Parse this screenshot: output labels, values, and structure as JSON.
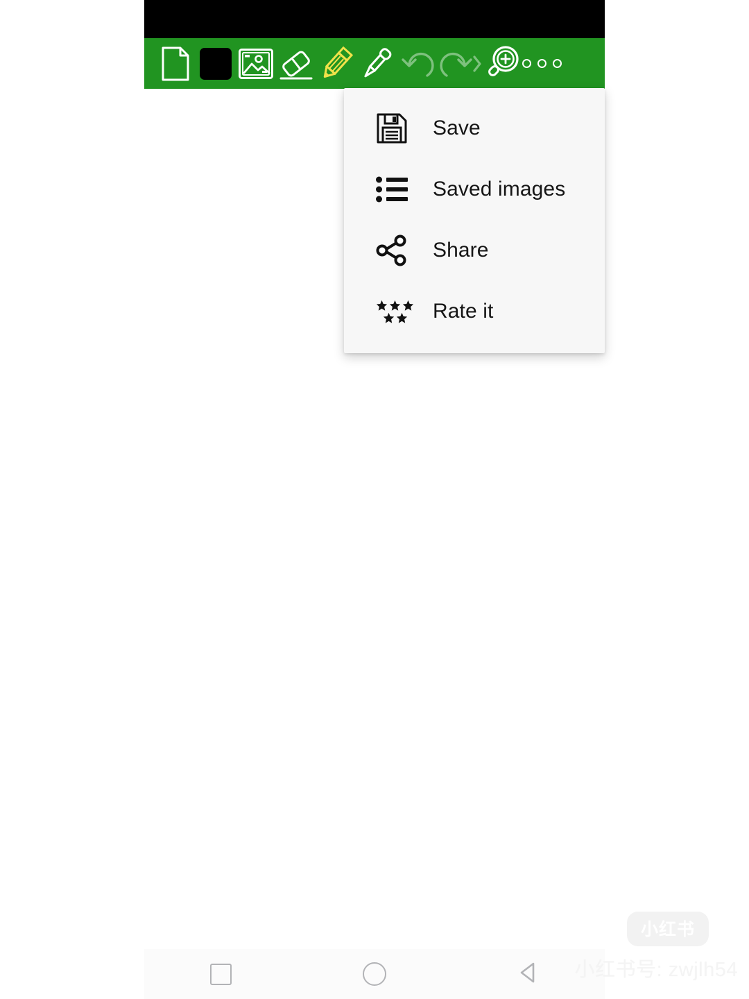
{
  "app": {
    "toolbar_color": "#219421",
    "status_bar_color": "#000000",
    "canvas_color": "#ffffff"
  },
  "toolbar": {
    "tools": [
      {
        "name": "new-page-icon",
        "label": "New page",
        "state": "enabled"
      },
      {
        "name": "color-swatch",
        "label": "Color",
        "state": "enabled",
        "color": "#000000"
      },
      {
        "name": "image-icon",
        "label": "Image",
        "state": "enabled"
      },
      {
        "name": "eraser-icon",
        "label": "Eraser",
        "state": "enabled"
      },
      {
        "name": "pencil-icon",
        "label": "Pencil",
        "state": "selected",
        "color": "#f0e24a"
      },
      {
        "name": "dropper-icon",
        "label": "Color picker",
        "state": "enabled"
      },
      {
        "name": "undo-icon",
        "label": "Undo",
        "state": "disabled"
      },
      {
        "name": "redo-icon",
        "label": "Redo",
        "state": "disabled"
      },
      {
        "name": "zoom-in-icon",
        "label": "Zoom in",
        "state": "enabled"
      },
      {
        "name": "overflow-icon",
        "label": "More options",
        "state": "open"
      }
    ]
  },
  "overflow_menu": {
    "background": "#f7f7f7",
    "items": [
      {
        "icon": "floppy-disk-icon",
        "label": "Save"
      },
      {
        "icon": "list-icon",
        "label": "Saved images"
      },
      {
        "icon": "share-icon",
        "label": "Share"
      },
      {
        "icon": "stars-icon",
        "label": "Rate it"
      }
    ]
  },
  "nav_bar": {
    "buttons": [
      {
        "icon": "recents-square-icon",
        "label": "Recents"
      },
      {
        "icon": "home-circle-icon",
        "label": "Home"
      },
      {
        "icon": "back-triangle-icon",
        "label": "Back"
      }
    ]
  },
  "watermark": {
    "badge": "小红书",
    "text": "小红书号: zwjlh54"
  }
}
